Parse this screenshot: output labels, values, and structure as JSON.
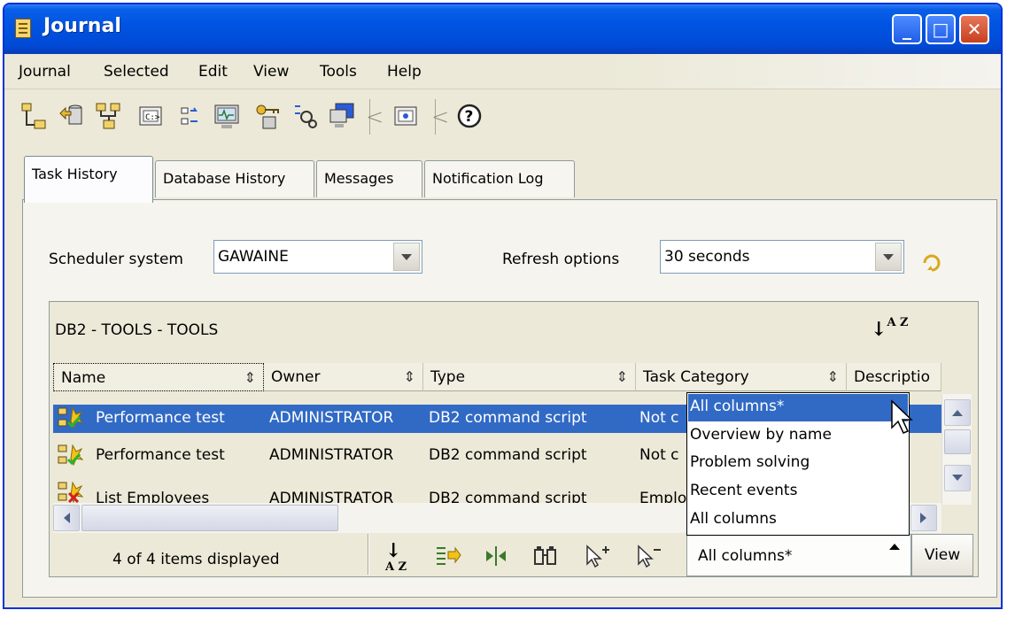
{
  "window": {
    "title": "Journal",
    "controls": {
      "minimize": "_",
      "maximize": "□",
      "close": "✕"
    }
  },
  "menu": [
    "Journal",
    "Selected",
    "Edit",
    "View",
    "Tools",
    "Help"
  ],
  "toolbar": {
    "icons": [
      "control-center-icon",
      "replication-center-icon",
      "satellite-admin-icon",
      "command-editor-icon",
      "task-center-icon",
      "health-center-icon",
      "license-center-icon",
      "development-center-icon",
      "journal-icon",
      "web-tools-icon",
      "help-icon"
    ]
  },
  "tabs": [
    "Task History",
    "Database History",
    "Messages",
    "Notification Log"
  ],
  "filters": {
    "scheduler_label": "Scheduler system",
    "scheduler_value": "GAWAINE",
    "refresh_label": "Refresh options",
    "refresh_value": "30 seconds"
  },
  "table": {
    "title": "DB2 - TOOLS - TOOLS",
    "sort_label": "A Z",
    "columns": [
      "Name",
      "Owner",
      "Type",
      "Task Category",
      "Descriptio"
    ],
    "sort_glyph": "⇕",
    "rows": [
      {
        "name": "Performance test",
        "owner": "ADMINISTRATOR",
        "type": "DB2 command script",
        "category": "Not c",
        "selected": true,
        "status": "success"
      },
      {
        "name": "Performance test",
        "owner": "ADMINISTRATOR",
        "type": "DB2 command script",
        "category": "Not c",
        "selected": false,
        "status": "success"
      },
      {
        "name": "List Employees",
        "owner": "ADMINISTRATOR",
        "type": "DB2 command script",
        "category": "Emplo",
        "selected": false,
        "status": "failure"
      }
    ]
  },
  "status": {
    "count_text": "4 of 4 items displayed",
    "view_value": "All columns*",
    "view_button": "View"
  },
  "view_menu": {
    "options": [
      "All columns*",
      "Overview by name",
      "Problem solving",
      "Recent events",
      "All columns"
    ],
    "highlighted": 0
  },
  "colors": {
    "title_bar": "#0054e3",
    "selection": "#316ac5",
    "window_bg": "#ece9d8",
    "close_button": "#c6401f"
  }
}
